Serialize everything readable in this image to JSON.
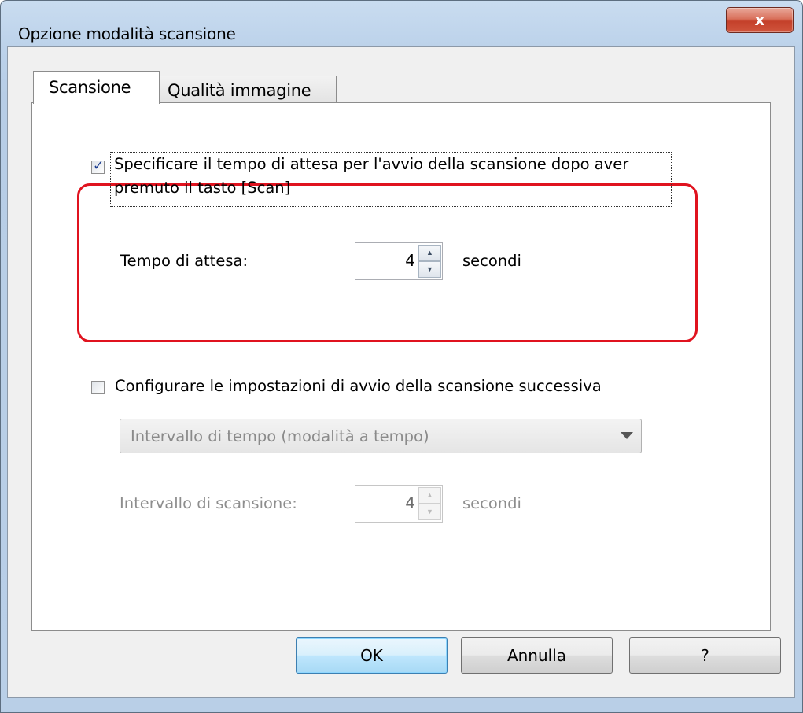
{
  "window": {
    "title": "Opzione modalità scansione",
    "close_label": "x"
  },
  "tabs": [
    {
      "label": "Scansione",
      "active": true
    },
    {
      "label": "Qualità immagine",
      "active": false
    }
  ],
  "wait_option": {
    "checked": true,
    "label_line1": "Specificare il tempo di attesa per l'avvio della scansione dopo aver",
    "label_line2": "premuto il tasto [Scan]",
    "wait_label": "Tempo di attesa:",
    "wait_value": "4",
    "wait_unit": "secondi"
  },
  "next_scan_option": {
    "checked": false,
    "label": "Configurare le impostazioni di avvio della scansione successiva",
    "mode_selected": "Intervallo di tempo (modalità a tempo)",
    "interval_label": "Intervallo di scansione:",
    "interval_value": "4",
    "interval_unit": "secondi"
  },
  "buttons": {
    "ok": "OK",
    "cancel": "Annulla",
    "help": "?"
  },
  "colors": {
    "highlight": "#e0131f",
    "checkmark": "#1e3f91",
    "default_button": "#3c7fb1"
  }
}
